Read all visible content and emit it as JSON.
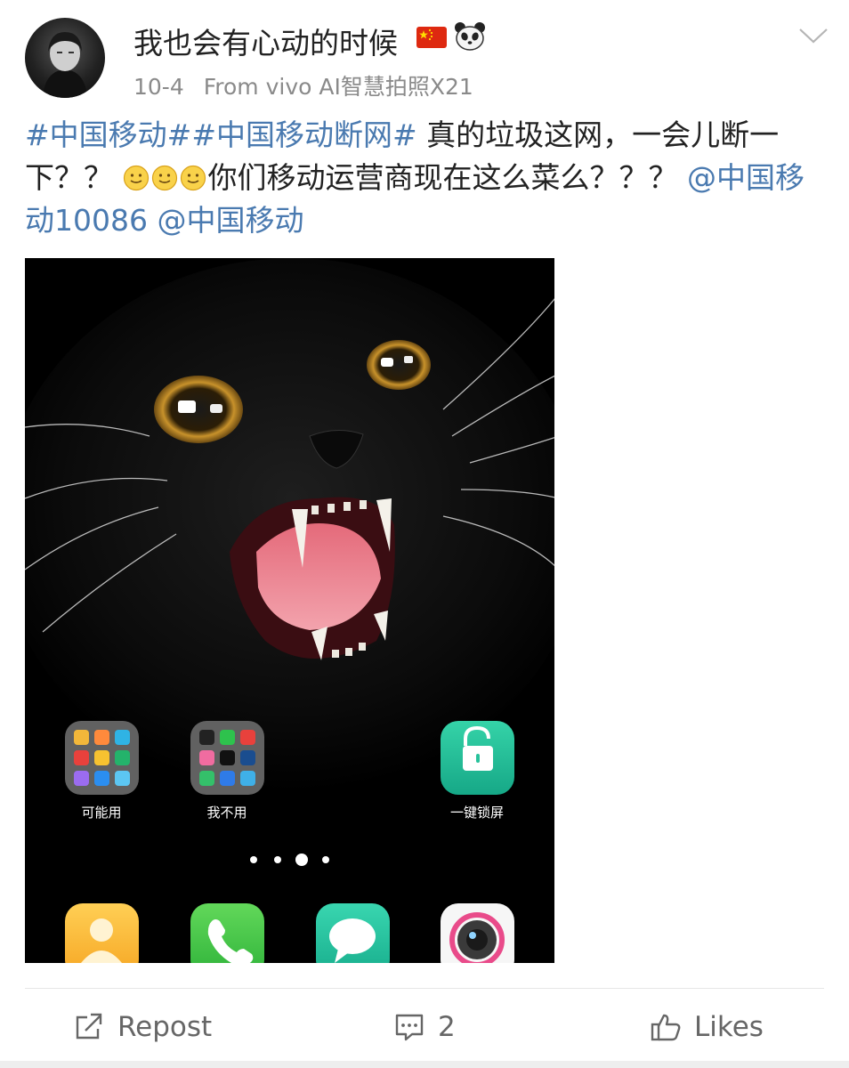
{
  "post": {
    "username": "我也会有心动的时候",
    "date": "10-4",
    "source": "From vivo AI智慧拍照X21",
    "text": {
      "hashtag1": "#中国移动#",
      "hashtag2": "#中国移动断网#",
      "body1": " 真的垃圾这网，一会儿断一下？？",
      "body2": "你们移动运营商现在这么菜么？？？",
      "mention1": "@中国移动10086",
      "mention2": "@中国移动"
    },
    "badges": [
      "flag-icon",
      "panda-icon"
    ],
    "emojis": [
      "smile-emoji",
      "smile-emoji",
      "smile-emoji"
    ]
  },
  "screenshot": {
    "folders": [
      {
        "label": "可能用"
      },
      {
        "label": "我不用"
      }
    ],
    "lock_app": {
      "label": "一键锁屏"
    },
    "page_dots": 4,
    "active_dot": 3,
    "dock": [
      "contacts-icon",
      "phone-icon",
      "messages-icon",
      "camera-icon"
    ]
  },
  "actions": {
    "repost_label": "Repost",
    "comment_count": "2",
    "likes_label": "Likes"
  },
  "colors": {
    "link": "#4a7ab0",
    "meta": "#8a8a8a",
    "lock_green": "#27c29b"
  }
}
